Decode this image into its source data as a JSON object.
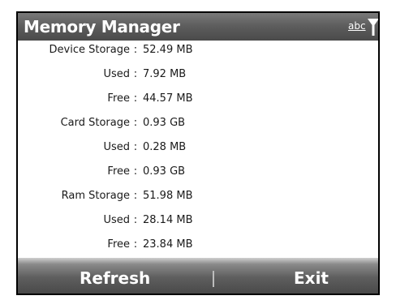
{
  "window": {
    "title": "Memory Manager",
    "input_mode": "abc",
    "signal_icon": "signal-strength-icon"
  },
  "memory": [
    {
      "label": "Device Storage",
      "separator": ":",
      "value": "52.49 MB"
    },
    {
      "label": "Used",
      "separator": ":",
      "value": "7.92 MB"
    },
    {
      "label": "Free",
      "separator": ":",
      "value": "44.57 MB"
    },
    {
      "label": "Card Storage",
      "separator": ":",
      "value": "0.93 GB"
    },
    {
      "label": "Used",
      "separator": ":",
      "value": "0.28 MB"
    },
    {
      "label": "Free",
      "separator": ":",
      "value": "0.93 GB"
    },
    {
      "label": "Ram Storage",
      "separator": ":",
      "value": "51.98 MB"
    },
    {
      "label": "Used",
      "separator": ":",
      "value": "28.14 MB"
    },
    {
      "label": "Free",
      "separator": ":",
      "value": "23.84 MB"
    }
  ],
  "softkeys": {
    "left_label": "Refresh",
    "right_label": "Exit"
  },
  "colors": {
    "title_bar": "#5e5e5e",
    "softkey_bar": "#4a4a4a",
    "text": "#1a1a1a",
    "background": "#ffffff"
  }
}
